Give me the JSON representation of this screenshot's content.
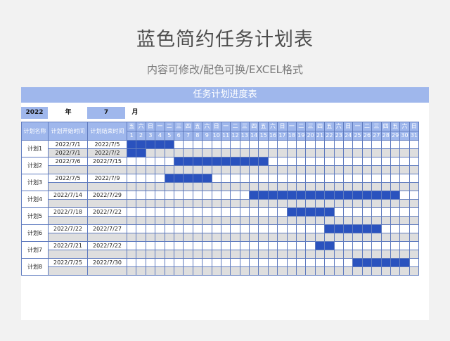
{
  "title": "蓝色简约任务计划表",
  "subtitle": "内容可修改/配色可换/EXCEL格式",
  "sheet": {
    "banner": "任务计划进度表",
    "year_value": "2022",
    "year_label": "年",
    "month_value": "7",
    "month_label": "月",
    "headers": {
      "name": "计划名称",
      "start": "计划开始时间",
      "end": "计划结束时间"
    },
    "weekdays": [
      "五",
      "六",
      "日",
      "一",
      "二",
      "三",
      "四",
      "五",
      "六",
      "日",
      "一",
      "二",
      "三",
      "四",
      "五",
      "六",
      "日",
      "一",
      "二",
      "三",
      "四",
      "五",
      "六",
      "日",
      "一",
      "二",
      "三",
      "四",
      "五",
      "六",
      "日"
    ],
    "days": [
      "1",
      "2",
      "3",
      "4",
      "5",
      "6",
      "7",
      "8",
      "9",
      "10",
      "11",
      "12",
      "13",
      "14",
      "15",
      "16",
      "17",
      "18",
      "19",
      "20",
      "21",
      "22",
      "23",
      "24",
      "25",
      "26",
      "27",
      "28",
      "29",
      "30",
      "31"
    ],
    "plans": [
      {
        "name": "计划1",
        "rows": [
          {
            "start": "2022/7/1",
            "end": "2022/7/5",
            "from": 1,
            "to": 5
          },
          {
            "start": "2022/7/1",
            "end": "2022/7/2",
            "from": 1,
            "to": 2
          }
        ]
      },
      {
        "name": "计划2",
        "rows": [
          {
            "start": "2022/7/6",
            "end": "2022/7/15",
            "from": 6,
            "to": 15
          },
          {
            "start": "",
            "end": "",
            "from": 0,
            "to": 0
          }
        ]
      },
      {
        "name": "计划3",
        "rows": [
          {
            "start": "2022/7/5",
            "end": "2022/7/9",
            "from": 5,
            "to": 9
          },
          {
            "start": "",
            "end": "",
            "from": 0,
            "to": 0
          }
        ]
      },
      {
        "name": "计划4",
        "rows": [
          {
            "start": "2022/7/14",
            "end": "2022/7/29",
            "from": 14,
            "to": 29
          },
          {
            "start": "",
            "end": "",
            "from": 0,
            "to": 0
          }
        ]
      },
      {
        "name": "计划5",
        "rows": [
          {
            "start": "2022/7/18",
            "end": "2022/7/22",
            "from": 18,
            "to": 22
          },
          {
            "start": "",
            "end": "",
            "from": 0,
            "to": 0
          }
        ]
      },
      {
        "name": "计划6",
        "rows": [
          {
            "start": "2022/7/22",
            "end": "2022/7/27",
            "from": 22,
            "to": 27
          },
          {
            "start": "",
            "end": "",
            "from": 0,
            "to": 0
          }
        ]
      },
      {
        "name": "计划7",
        "rows": [
          {
            "start": "2022/7/21",
            "end": "2022/7/22",
            "from": 21,
            "to": 22
          },
          {
            "start": "",
            "end": "",
            "from": 0,
            "to": 0
          }
        ]
      },
      {
        "name": "计划8",
        "rows": [
          {
            "start": "2022/7/25",
            "end": "2022/7/30",
            "from": 25,
            "to": 30
          },
          {
            "start": "",
            "end": "",
            "from": 0,
            "to": 0
          }
        ]
      }
    ],
    "colors": {
      "header": "#9fb7ec",
      "bar": "#2a52be",
      "border": "#5f7bbf",
      "shade": "#dedede"
    }
  }
}
